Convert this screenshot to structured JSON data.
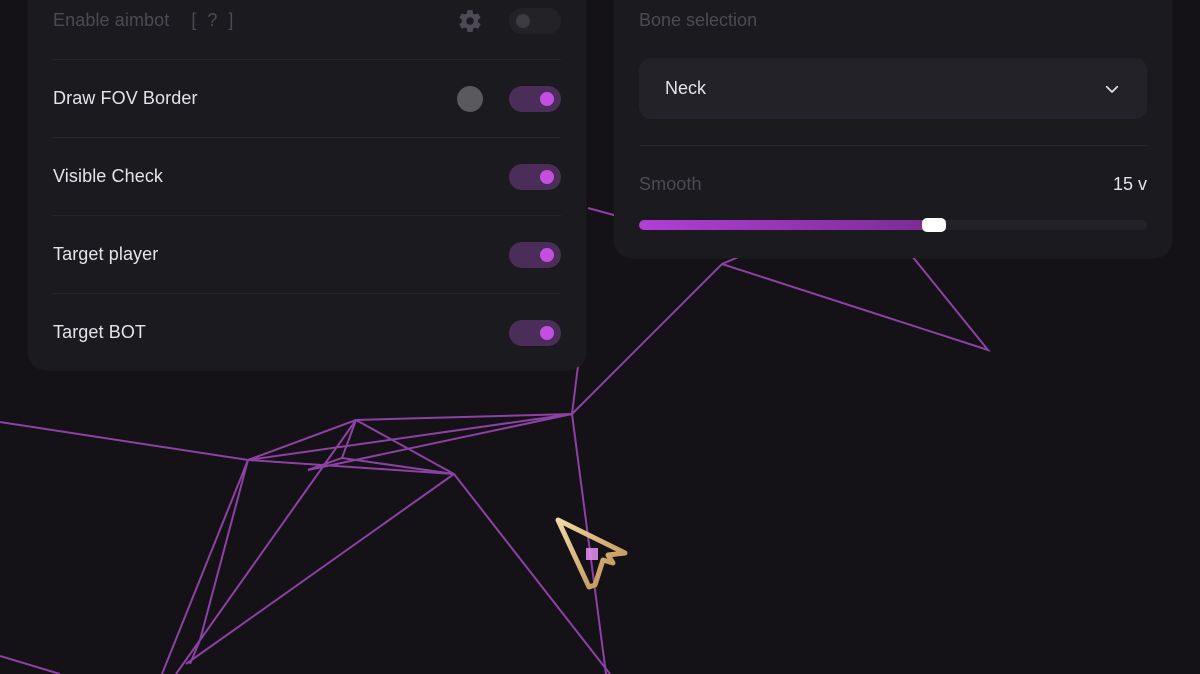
{
  "aimbot": {
    "enable_label": "Enable aimbot",
    "enable_hint": "[ ? ]",
    "enable_on": false,
    "rows": [
      {
        "label": "Draw FOV Border",
        "on": true
      },
      {
        "label": "Visible Check",
        "on": true
      },
      {
        "label": "Target player",
        "on": true
      },
      {
        "label": "Target BOT",
        "on": true
      }
    ]
  },
  "bone": {
    "title": "Bone selection",
    "selected": "Neck",
    "smooth_label": "Smooth",
    "smooth_value": "15 v",
    "smooth_fraction": 0.58
  },
  "icons": {
    "settings": "gear-icon",
    "color": "color-swatch",
    "dropdown": "chevron-down-icon",
    "cursor": "mouse-cursor-icon"
  },
  "colors": {
    "accent": "#c34fe0",
    "lines": "#9b47b5",
    "background": "#141216",
    "panel": "#1b1a1f"
  }
}
